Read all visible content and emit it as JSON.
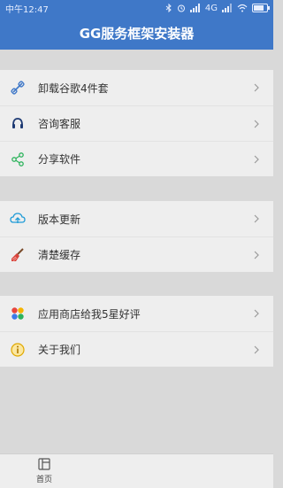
{
  "status": {
    "time": "中午12:47",
    "signal": "4G"
  },
  "header": {
    "title": "GG服务框架安装器"
  },
  "group1": [
    {
      "label": "卸载谷歌4件套",
      "icon": "link-icon"
    },
    {
      "label": "咨询客服",
      "icon": "headset-icon"
    },
    {
      "label": "分享软件",
      "icon": "share-icon"
    }
  ],
  "group2": [
    {
      "label": "版本更新",
      "icon": "cloud-upload-icon"
    },
    {
      "label": "清楚缓存",
      "icon": "broom-icon"
    }
  ],
  "group3": [
    {
      "label": "应用商店给我5星好评",
      "icon": "app-grid-icon"
    },
    {
      "label": "关于我们",
      "icon": "info-icon"
    }
  ],
  "nav": {
    "home_label": "首页"
  },
  "colors": {
    "accent": "#3f78c8",
    "background": "#d9d9d9",
    "row": "#eeeeee"
  }
}
